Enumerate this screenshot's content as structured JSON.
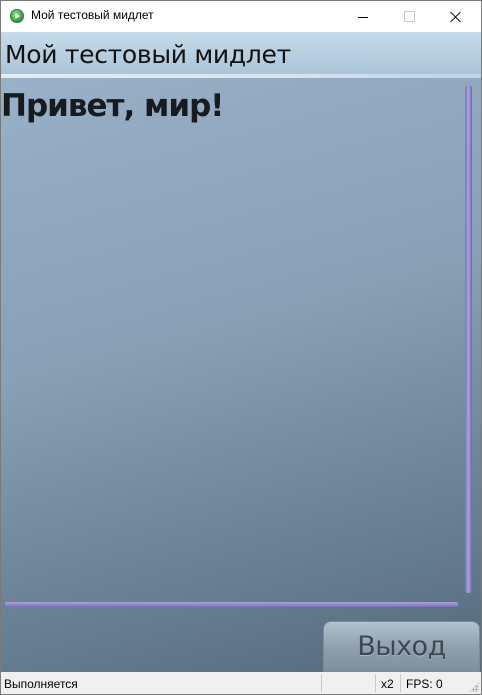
{
  "window": {
    "title": "Мой тестовый мидлет",
    "icon": "play-icon"
  },
  "midlet": {
    "screen_title": "Мой тестовый мидлет",
    "text": "Привет, мир!",
    "command_exit_label": "Выход"
  },
  "statusbar": {
    "state": "Выполняется",
    "zoom": "x2",
    "fps": "FPS: 0"
  },
  "colors": {
    "accent_scrollbar": "#8f8ad0",
    "screen_background": "#8aa0b6",
    "title_strip": "#b9d0e2"
  }
}
